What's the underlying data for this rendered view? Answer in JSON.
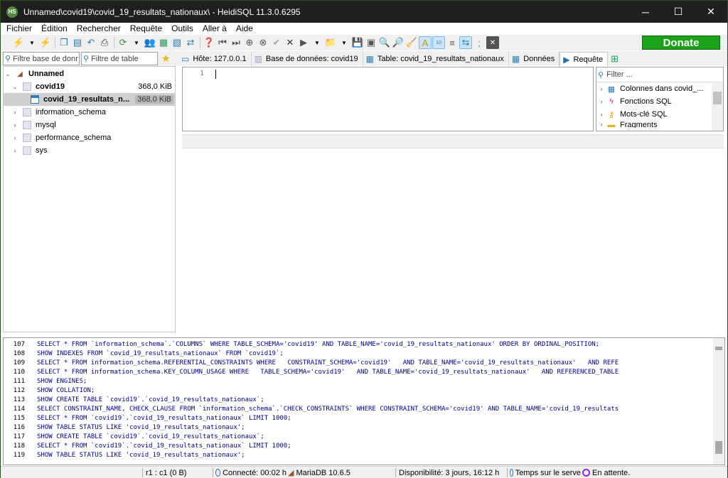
{
  "window": {
    "title": "Unnamed\\covid19\\covid_19_resultats_nationaux\\ - HeidiSQL 11.3.0.6295",
    "app_icon_text": "HS",
    "minimize": "─",
    "maximize": "☐",
    "close": "✕"
  },
  "menu": [
    "Fichier",
    "Édition",
    "Rechercher",
    "Requête",
    "Outils",
    "Aller à",
    "Aide"
  ],
  "toolbar": {
    "donate_label": "Donate"
  },
  "filters": {
    "db_filter_placeholder": "Filtre base de donr",
    "table_filter_placeholder": "Filtre de table"
  },
  "tabs": [
    {
      "label": "Hôte: 127.0.0.1",
      "icon": "host-icon"
    },
    {
      "label": "Base de données: covid19",
      "icon": "database-icon"
    },
    {
      "label": "Table: covid_19_resultats_nationaux",
      "icon": "table-icon"
    },
    {
      "label": "Données",
      "icon": "grid-icon"
    },
    {
      "label": "Requête",
      "icon": "play-icon"
    }
  ],
  "tree": {
    "root": "Unnamed",
    "db_covid19": "covid19",
    "db_covid19_size": "368,0 KiB",
    "table": "covid_19_resultats_n...",
    "table_size": "368,0 KiB",
    "others": [
      "information_schema",
      "mysql",
      "performance_schema",
      "sys"
    ]
  },
  "editor": {
    "line_number": "1"
  },
  "helper": {
    "filter_placeholder": "Filter ...",
    "items": [
      "Colonnes dans covid_...",
      "Fonctions SQL",
      "Mots-clé SQL",
      "Fragments"
    ]
  },
  "log": [
    {
      "n": "107",
      "t": "SELECT * FROM `information_schema`.`COLUMNS` WHERE TABLE_SCHEMA='covid19' AND TABLE_NAME='covid_19_resultats_nationaux' ORDER BY ORDINAL_POSITION;"
    },
    {
      "n": "108",
      "t": "SHOW INDEXES FROM `covid_19_resultats_nationaux` FROM `covid19`;"
    },
    {
      "n": "109",
      "t": "SELECT * FROM information_schema.REFERENTIAL_CONSTRAINTS WHERE   CONSTRAINT_SCHEMA='covid19'   AND TABLE_NAME='covid_19_resultats_nationaux'   AND REFE"
    },
    {
      "n": "110",
      "t": "SELECT * FROM information_schema.KEY_COLUMN_USAGE WHERE   TABLE_SCHEMA='covid19'   AND TABLE_NAME='covid_19_resultats_nationaux'   AND REFERENCED_TABLE"
    },
    {
      "n": "111",
      "t": "SHOW ENGINES;"
    },
    {
      "n": "112",
      "t": "SHOW COLLATION;"
    },
    {
      "n": "113",
      "t": "SHOW CREATE TABLE `covid19`.`covid_19_resultats_nationaux`;"
    },
    {
      "n": "114",
      "t": "SELECT CONSTRAINT_NAME, CHECK_CLAUSE FROM `information_schema`.`CHECK_CONSTRAINTS` WHERE CONSTRAINT_SCHEMA='covid19' AND TABLE_NAME='covid_19_resultats"
    },
    {
      "n": "115",
      "t": "SELECT * FROM `covid19`.`covid_19_resultats_nationaux` LIMIT 1000;"
    },
    {
      "n": "116",
      "t": "SHOW TABLE STATUS LIKE 'covid_19_resultats_nationaux';"
    },
    {
      "n": "117",
      "t": "SHOW CREATE TABLE `covid19`.`covid_19_resultats_nationaux`;"
    },
    {
      "n": "118",
      "t": "SELECT * FROM `covid19`.`covid_19_resultats_nationaux` LIMIT 1000;"
    },
    {
      "n": "119",
      "t": "SHOW TABLE STATUS LIKE 'covid_19_resultats_nationaux';"
    }
  ],
  "status": {
    "cursor": "r1 : c1 (0 B)",
    "connected": "Connecté: 00:02 h",
    "server": "MariaDB 10.6.5",
    "uptime": "Disponibilité: 3 jours, 16:12 h",
    "server_time": "Temps sur le serve",
    "state": "En attente."
  },
  "colors": {
    "titlebar": "#1f1f1f",
    "donate": "#1aa21a",
    "sql_text": "#00008b"
  }
}
